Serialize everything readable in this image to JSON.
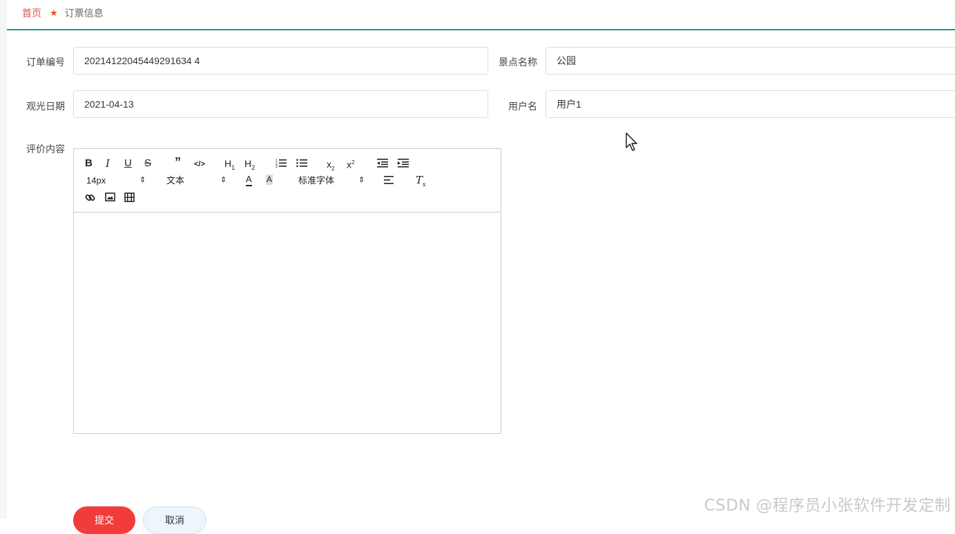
{
  "breadcrumb": {
    "home": "首页",
    "current": "订票信息"
  },
  "form": {
    "order_no": {
      "label": "订单编号",
      "value": "20214122045449291634 4"
    },
    "spot_name": {
      "label": "景点名称",
      "value": "公园"
    },
    "visit_date": {
      "label": "观光日期",
      "value": "2021-04-13"
    },
    "username": {
      "label": "用户名",
      "value": "用户1"
    },
    "review": {
      "label": "评价内容"
    }
  },
  "editor": {
    "font_size": "14px",
    "paragraph": "文本",
    "font_family": "标准字体",
    "icons": [
      "bold-icon",
      "italic-icon",
      "underline-icon",
      "strike-icon",
      "quote-icon",
      "code-icon",
      "h1-icon",
      "h2-icon",
      "ordered-list-icon",
      "bullet-list-icon",
      "subscript-icon",
      "superscript-icon",
      "outdent-icon",
      "indent-icon",
      "font-color-icon",
      "background-color-icon",
      "align-icon",
      "clear-format-icon",
      "link-icon",
      "image-icon",
      "video-icon"
    ]
  },
  "buttons": {
    "submit": "提交",
    "cancel": "取消"
  },
  "watermark": "CSDN @程序员小张软件开发定制",
  "colors": {
    "accent": "#1f8f8f",
    "home_link": "#d9534f",
    "submit": "#f23b3b",
    "cancel_bg": "#eef6fc"
  }
}
